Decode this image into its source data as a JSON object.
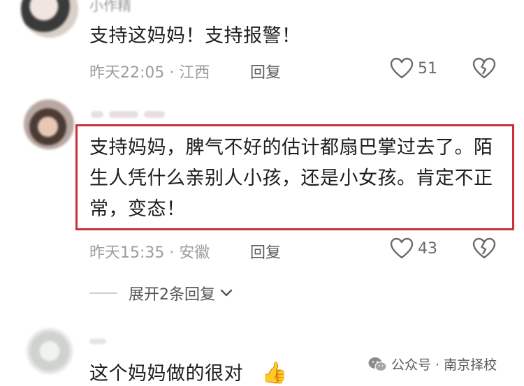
{
  "comments": [
    {
      "username": "小作精",
      "text": "支持这妈妈！支持报警！",
      "meta": "昨天22:05 · 江西",
      "reply_label": "回复",
      "likes": "51"
    },
    {
      "username": "",
      "text": "支持妈妈，脾气不好的估计都扇巴掌过去了。陌生人凭什么亲别人小孩，还是小女孩。肯定不正常，变态！",
      "meta": "昨天15:35 · 安徽",
      "reply_label": "回复",
      "likes": "43",
      "expand_label": "展开2条回复"
    },
    {
      "username": "",
      "text": "这个妈妈做的很对",
      "emoji": "👍"
    }
  ],
  "watermark": "公众号 · 南京择校",
  "icons": {
    "like": "heart-outline-icon",
    "dislike": "broken-heart-icon",
    "expand": "chevron-down-icon",
    "watermark": "wechat-icon"
  },
  "colors": {
    "highlight_border": "#c8303a"
  }
}
